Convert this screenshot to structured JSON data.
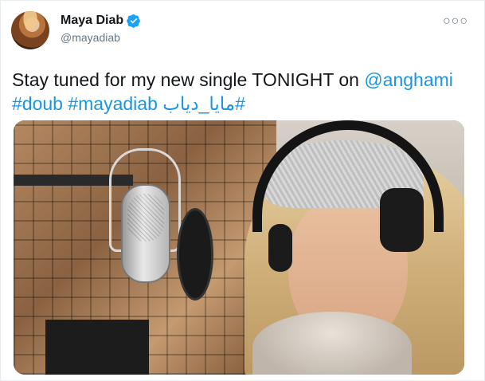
{
  "author": {
    "display_name": "Maya Diab",
    "handle": "@mayadiab",
    "verified": true
  },
  "menu_icon": "more-dots-icon",
  "tweet": {
    "line1_text": "Stay tuned for my new single TONIGHT on ",
    "mention": "@anghami",
    "hashtags": [
      "#doub",
      "#mayadiab",
      "#مايا_دياب"
    ]
  },
  "media": {
    "type": "video-still",
    "description": "singer recording with headphones and studio microphone"
  },
  "colors": {
    "link": "#1b95e0",
    "text": "#14171a",
    "secondary": "#657786",
    "verified": "#1da1f2"
  }
}
